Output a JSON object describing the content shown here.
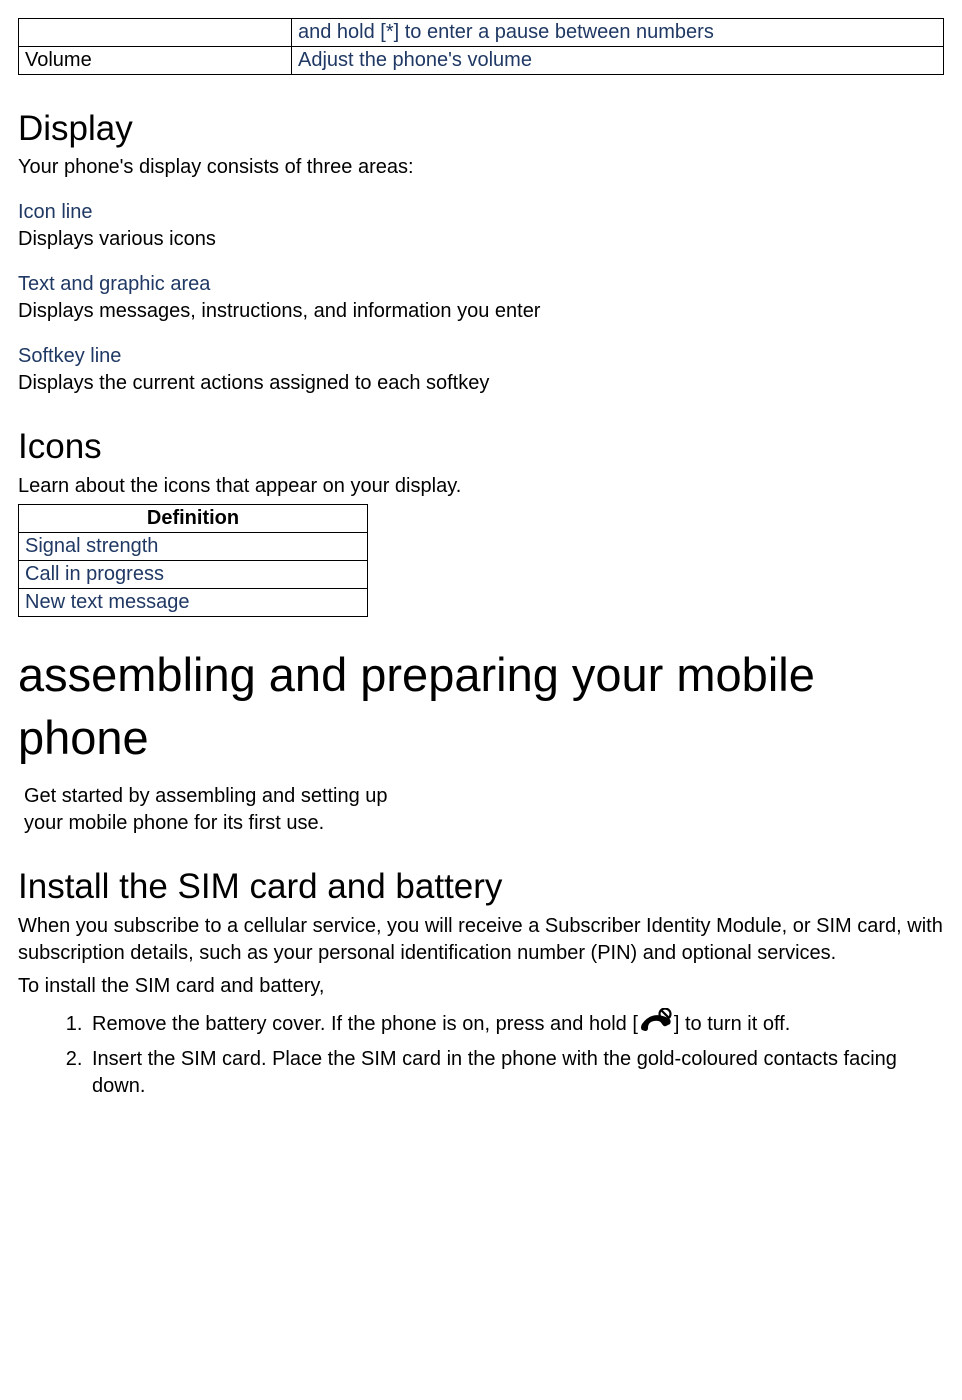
{
  "topTable": {
    "row1": {
      "col1": "",
      "col2": "and hold [*] to enter a pause between numbers"
    },
    "row2": {
      "col1": "Volume",
      "col2": "Adjust the phone's volume"
    }
  },
  "display": {
    "heading": "Display",
    "intro": "Your phone's display consists of three areas:",
    "iconLine": {
      "title": "Icon line",
      "body": "Displays various icons"
    },
    "textArea": {
      "title": "Text and graphic area",
      "body": "Displays messages, instructions, and information you enter"
    },
    "softkey": {
      "title": "Softkey line",
      "body": "Displays the current actions assigned to each softkey"
    }
  },
  "icons": {
    "heading": "Icons",
    "intro": "Learn about the icons that appear on your display.",
    "header": "Definition",
    "r1": "Signal strength",
    "r2": "Call in progress",
    "r3": "New text message"
  },
  "assembling": {
    "heading": "assembling and preparing your mobile phone",
    "intro1": "Get started by assembling and setting up",
    "intro2": " your mobile phone for its first use."
  },
  "install": {
    "heading": "Install the SIM card and battery",
    "p1": "When you subscribe to a cellular service, you will receive a Subscriber Identity Module, or SIM card, with subscription details, such as your personal identification number (PIN) and optional services.",
    "p2": "To install the SIM card and battery,",
    "step1a": "Remove the battery cover. If the phone is on, press and hold [",
    "step1b": "] to turn it off.",
    "step2": "Insert the SIM card. Place the SIM card in the phone with the gold-coloured contacts facing down."
  }
}
